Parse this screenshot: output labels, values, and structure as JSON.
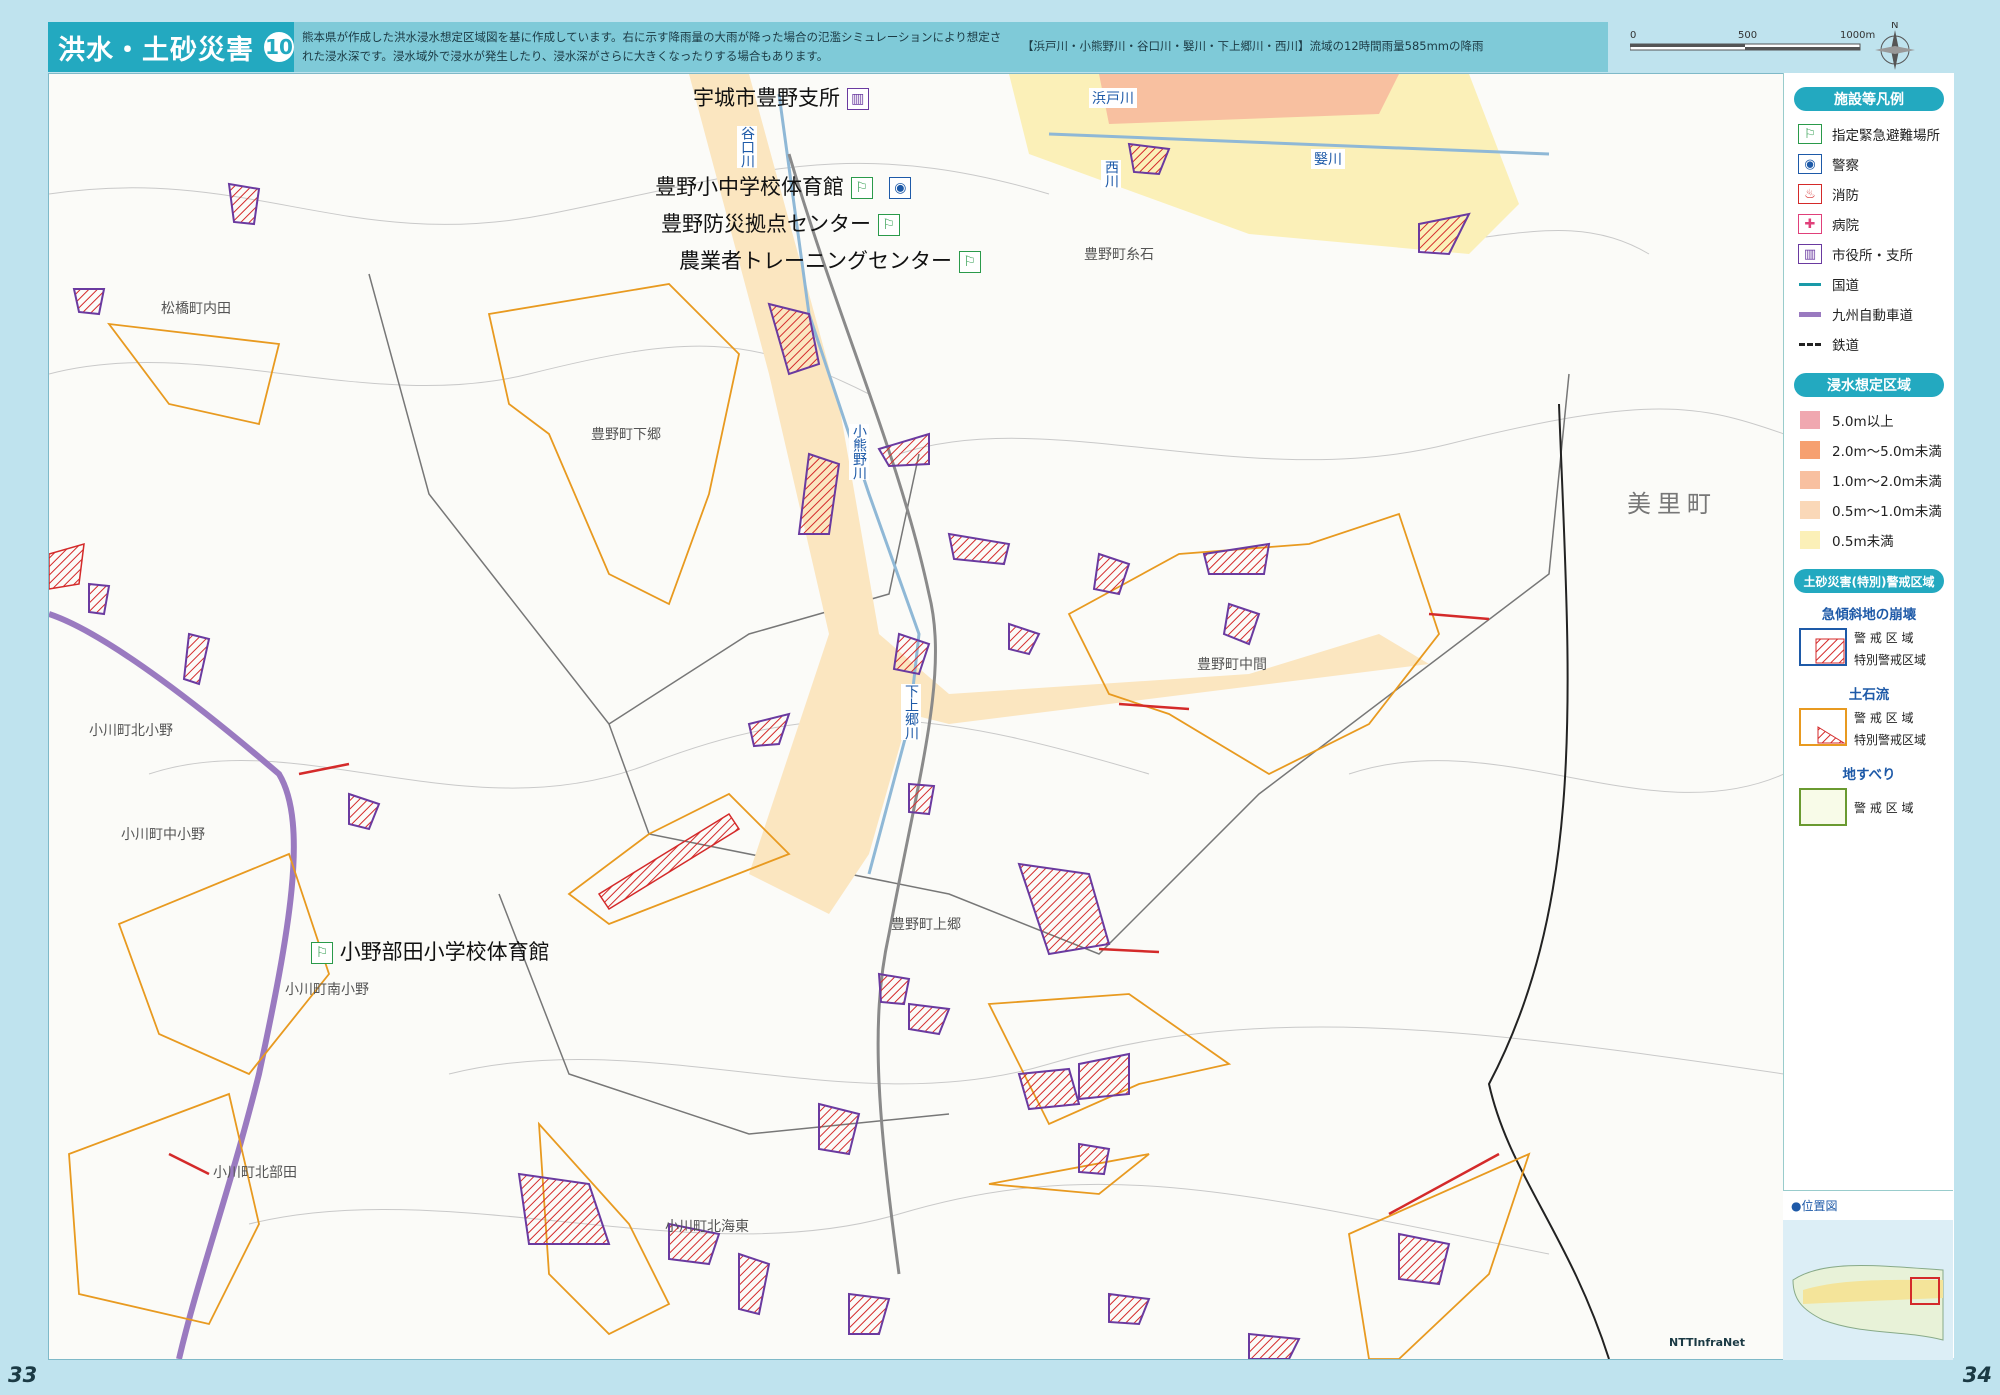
{
  "header": {
    "title": "洪水・土砂災害",
    "number": "10",
    "description": "熊本県が作成した洪水浸水想定区域図を基に作成しています。右に示す降雨量の大雨が降った場合の氾濫シミュレーションにより想定された浸水深です。浸水域外で浸水が発生したり、浸水深がさらに大きくなったりする場合もあります。",
    "basin_note": "【浜戸川・小熊野川・谷口川・嫛川・下上郷川・西川】流域の12時間雨量585mmの降雨"
  },
  "scale": {
    "ticks": [
      "0",
      "500",
      "1000m"
    ],
    "north": "N"
  },
  "legend": {
    "facilities_title": "施設等凡例",
    "facilities": [
      {
        "icon": "evacuation-icon",
        "label": "指定緊急避難場所",
        "color": "#2a9a4a"
      },
      {
        "icon": "police-icon",
        "label": "警察",
        "color": "#1e5aa8"
      },
      {
        "icon": "fire-icon",
        "label": "消防",
        "color": "#d42a2a"
      },
      {
        "icon": "hospital-icon",
        "label": "病院",
        "color": "#e0407a"
      },
      {
        "icon": "city-office-icon",
        "label": "市役所・支所",
        "color": "#6a3aa0"
      },
      {
        "icon": "national-road-icon",
        "label": "国道",
        "color": "#1a9aa8"
      },
      {
        "icon": "expressway-icon",
        "label": "九州自動車道",
        "color": "#9a7ac0"
      },
      {
        "icon": "railway-icon",
        "label": "鉄道",
        "color": "#222222"
      }
    ],
    "flood_title": "浸水想定区域",
    "flood_levels": [
      {
        "label": "5.0m以上",
        "color": "#f0a8b0"
      },
      {
        "label": "2.0m～5.0m未満",
        "color": "#f6a070"
      },
      {
        "label": "1.0m～2.0m未満",
        "color": "#f8c0a0"
      },
      {
        "label": "0.5m～1.0m未満",
        "color": "#fad8b8"
      },
      {
        "label": "0.5m未満",
        "color": "#fbf0b8"
      }
    ],
    "sediment_title": "土砂災害(特別)警戒区域",
    "steep_slope": "急傾斜地の崩壊",
    "debris_flow": "土石流",
    "landslide": "地すべり",
    "warning_zone": "警 戒 区 域",
    "special_zone": "特別警戒区域",
    "locator_title": "●位置図"
  },
  "map": {
    "facilities": [
      {
        "name": "宇城市豊野支所",
        "kind": "city-office-icon"
      },
      {
        "name": "豊野小中学校体育館",
        "kind": "evacuation-icon"
      },
      {
        "name": "豊野防災拠点センター",
        "kind": "evacuation-icon"
      },
      {
        "name": "農業者トレーニングセンター",
        "kind": "evacuation-icon"
      },
      {
        "name": "小野部田小学校体育館",
        "kind": "evacuation-icon"
      }
    ],
    "rivers": [
      "浜戸川",
      "谷口川",
      "西川",
      "嫛川",
      "小熊野川",
      "下上郷川"
    ],
    "places": [
      "松橋町内田",
      "豊野町下郷",
      "豊野町糸石",
      "豊野町中間",
      "豊野町上郷",
      "小川町北小野",
      "小川町中小野",
      "小川町南小野",
      "小川町北部田",
      "小川町北海東"
    ],
    "town": "美里町",
    "credit": "NTTInfraNet"
  },
  "pages": {
    "left": "33",
    "right": "34"
  }
}
